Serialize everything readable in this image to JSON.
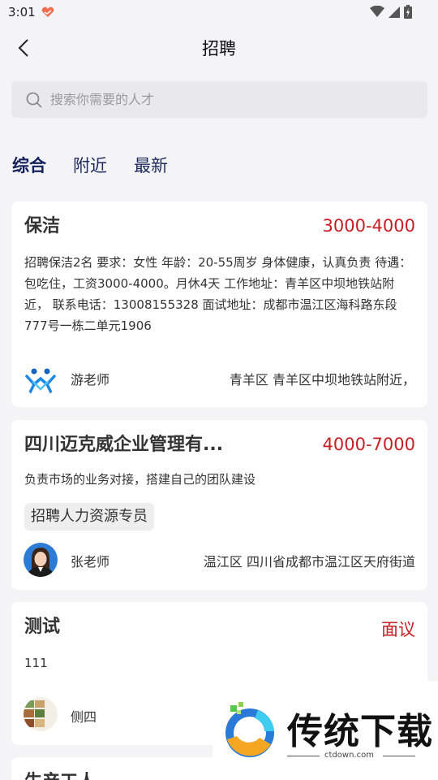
{
  "status_bar": {
    "time": "3:01"
  },
  "header": {
    "title": "招聘"
  },
  "search": {
    "placeholder": "搜索你需要的人才"
  },
  "tabs": [
    {
      "label": "综合",
      "active": true
    },
    {
      "label": "附近",
      "active": false
    },
    {
      "label": "最新",
      "active": false
    }
  ],
  "jobs": [
    {
      "title": "保洁",
      "salary": "3000-4000",
      "description": "招聘保洁2名 要求：女性 年龄：20-55周岁 身体健康，认真负责 待遇：包吃住，工资3000-4000。月休4天 工作地址：青羊区中坝地铁站附近， 联系电话：13008155328 面试地址：成都市温江区海科路东段777号一栋二单元1906",
      "poster": "游老师",
      "location": "青羊区 青羊区中坝地铁站附近，"
    },
    {
      "title": "四川迈克威企业管理有...",
      "salary": "4000-7000",
      "description": "负责市场的业务对接，搭建自己的团队建设",
      "tag": "招聘人力资源专员",
      "poster": "张老师",
      "location": "温江区 四川省成都市温江区天府街道"
    },
    {
      "title": "测试",
      "salary": "面议",
      "description": "111",
      "poster": "侧四",
      "location": ""
    },
    {
      "title": "生产工人"
    }
  ],
  "watermark": {
    "text": "传统下载",
    "url": "ctdown.com"
  }
}
